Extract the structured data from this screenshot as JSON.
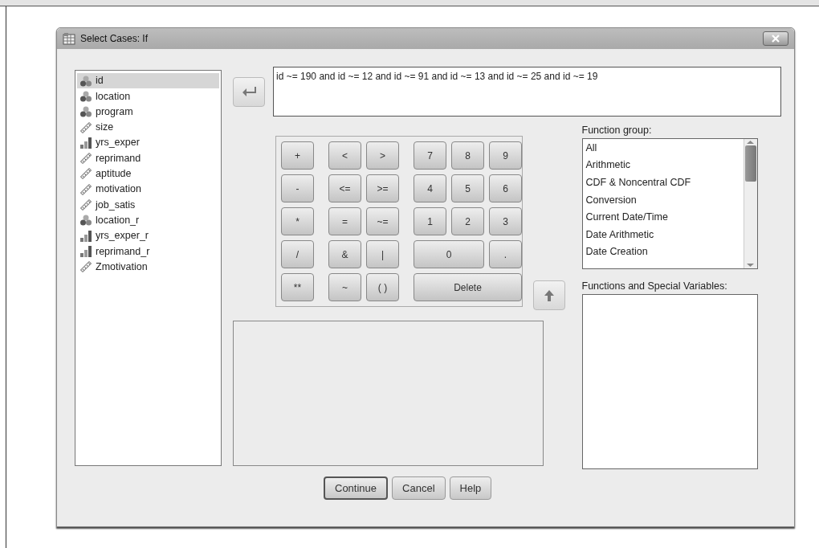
{
  "window": {
    "title": "Select Cases: If"
  },
  "variables": [
    {
      "name": "id",
      "kind": "nominal",
      "selected": true
    },
    {
      "name": "location",
      "kind": "nominal",
      "selected": false
    },
    {
      "name": "program",
      "kind": "nominal",
      "selected": false
    },
    {
      "name": "size",
      "kind": "scale",
      "selected": false
    },
    {
      "name": "yrs_exper",
      "kind": "ordinal",
      "selected": false
    },
    {
      "name": "reprimand",
      "kind": "scale",
      "selected": false
    },
    {
      "name": "aptitude",
      "kind": "scale",
      "selected": false
    },
    {
      "name": "motivation",
      "kind": "scale",
      "selected": false
    },
    {
      "name": "job_satis",
      "kind": "scale",
      "selected": false
    },
    {
      "name": "location_r",
      "kind": "nominal",
      "selected": false
    },
    {
      "name": "yrs_exper_r",
      "kind": "ordinal",
      "selected": false
    },
    {
      "name": "reprimand_r",
      "kind": "ordinal",
      "selected": false
    },
    {
      "name": "Zmotivation",
      "kind": "scale",
      "selected": false
    }
  ],
  "expression": "id ~= 190 and id ~= 12 and id ~= 91 and id ~= 13 and id ~= 25 and id ~= 19",
  "keypad": [
    [
      "+",
      "<",
      ">",
      "7",
      "8",
      "9"
    ],
    [
      "-",
      "<=",
      ">=",
      "4",
      "5",
      "6"
    ],
    [
      "*",
      "=",
      "~=",
      "1",
      "2",
      "3"
    ],
    [
      "/",
      "&",
      "|",
      "0",
      "."
    ],
    [
      "**",
      "~",
      "( )",
      "Delete"
    ]
  ],
  "function_group": {
    "label": "Function group:",
    "items": [
      {
        "label": "All",
        "selected": false
      },
      {
        "label": "Arithmetic",
        "selected": false
      },
      {
        "label": "CDF & Noncentral CDF",
        "selected": false
      },
      {
        "label": "Conversion",
        "selected": false
      },
      {
        "label": "Current Date/Time",
        "selected": false
      },
      {
        "label": "Date Arithmetic",
        "selected": false
      },
      {
        "label": "Date Creation",
        "selected": false
      }
    ]
  },
  "functions_label": "Functions and Special Variables:",
  "buttons": [
    {
      "label": "Continue",
      "default": true
    },
    {
      "label": "Cancel",
      "default": false
    },
    {
      "label": "Help",
      "default": false
    }
  ]
}
